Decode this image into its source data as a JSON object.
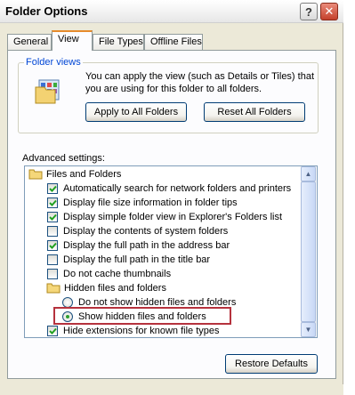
{
  "window": {
    "title": "Folder Options"
  },
  "titlebar_buttons": {
    "help": "?",
    "close": "✕"
  },
  "tabs": [
    {
      "label": "General"
    },
    {
      "label": "View"
    },
    {
      "label": "File Types"
    },
    {
      "label": "Offline Files"
    }
  ],
  "folder_views": {
    "legend": "Folder views",
    "description": "You can apply the view (such as Details or Tiles) that you are using for this folder to all folders.",
    "apply_button": "Apply to All Folders",
    "reset_button": "Reset All Folders"
  },
  "advanced": {
    "label": "Advanced settings:",
    "items": [
      {
        "type": "folder",
        "label": "Files and Folders"
      },
      {
        "type": "checkbox",
        "checked": true,
        "label": "Automatically search for network folders and printers"
      },
      {
        "type": "checkbox",
        "checked": true,
        "label": "Display file size information in folder tips"
      },
      {
        "type": "checkbox",
        "checked": true,
        "label": "Display simple folder view in Explorer's Folders list"
      },
      {
        "type": "checkbox",
        "checked": false,
        "label": "Display the contents of system folders"
      },
      {
        "type": "checkbox",
        "checked": true,
        "label": "Display the full path in the address bar"
      },
      {
        "type": "checkbox",
        "checked": false,
        "label": "Display the full path in the title bar"
      },
      {
        "type": "checkbox",
        "checked": false,
        "label": "Do not cache thumbnails"
      },
      {
        "type": "folder",
        "label": "Hidden files and folders"
      },
      {
        "type": "radio",
        "checked": false,
        "label": "Do not show hidden files and folders"
      },
      {
        "type": "radio",
        "checked": true,
        "label": "Show hidden files and folders"
      },
      {
        "type": "checkbox",
        "checked": true,
        "label": "Hide extensions for known file types"
      }
    ]
  },
  "restore_button": "Restore Defaults",
  "scrollbar": {
    "up": "▲",
    "down": "▼"
  },
  "colors": {
    "accent_tab": "#e68b2c",
    "legend": "#0046d5",
    "highlight": "#b5323d",
    "checkmark": "#21a121"
  }
}
